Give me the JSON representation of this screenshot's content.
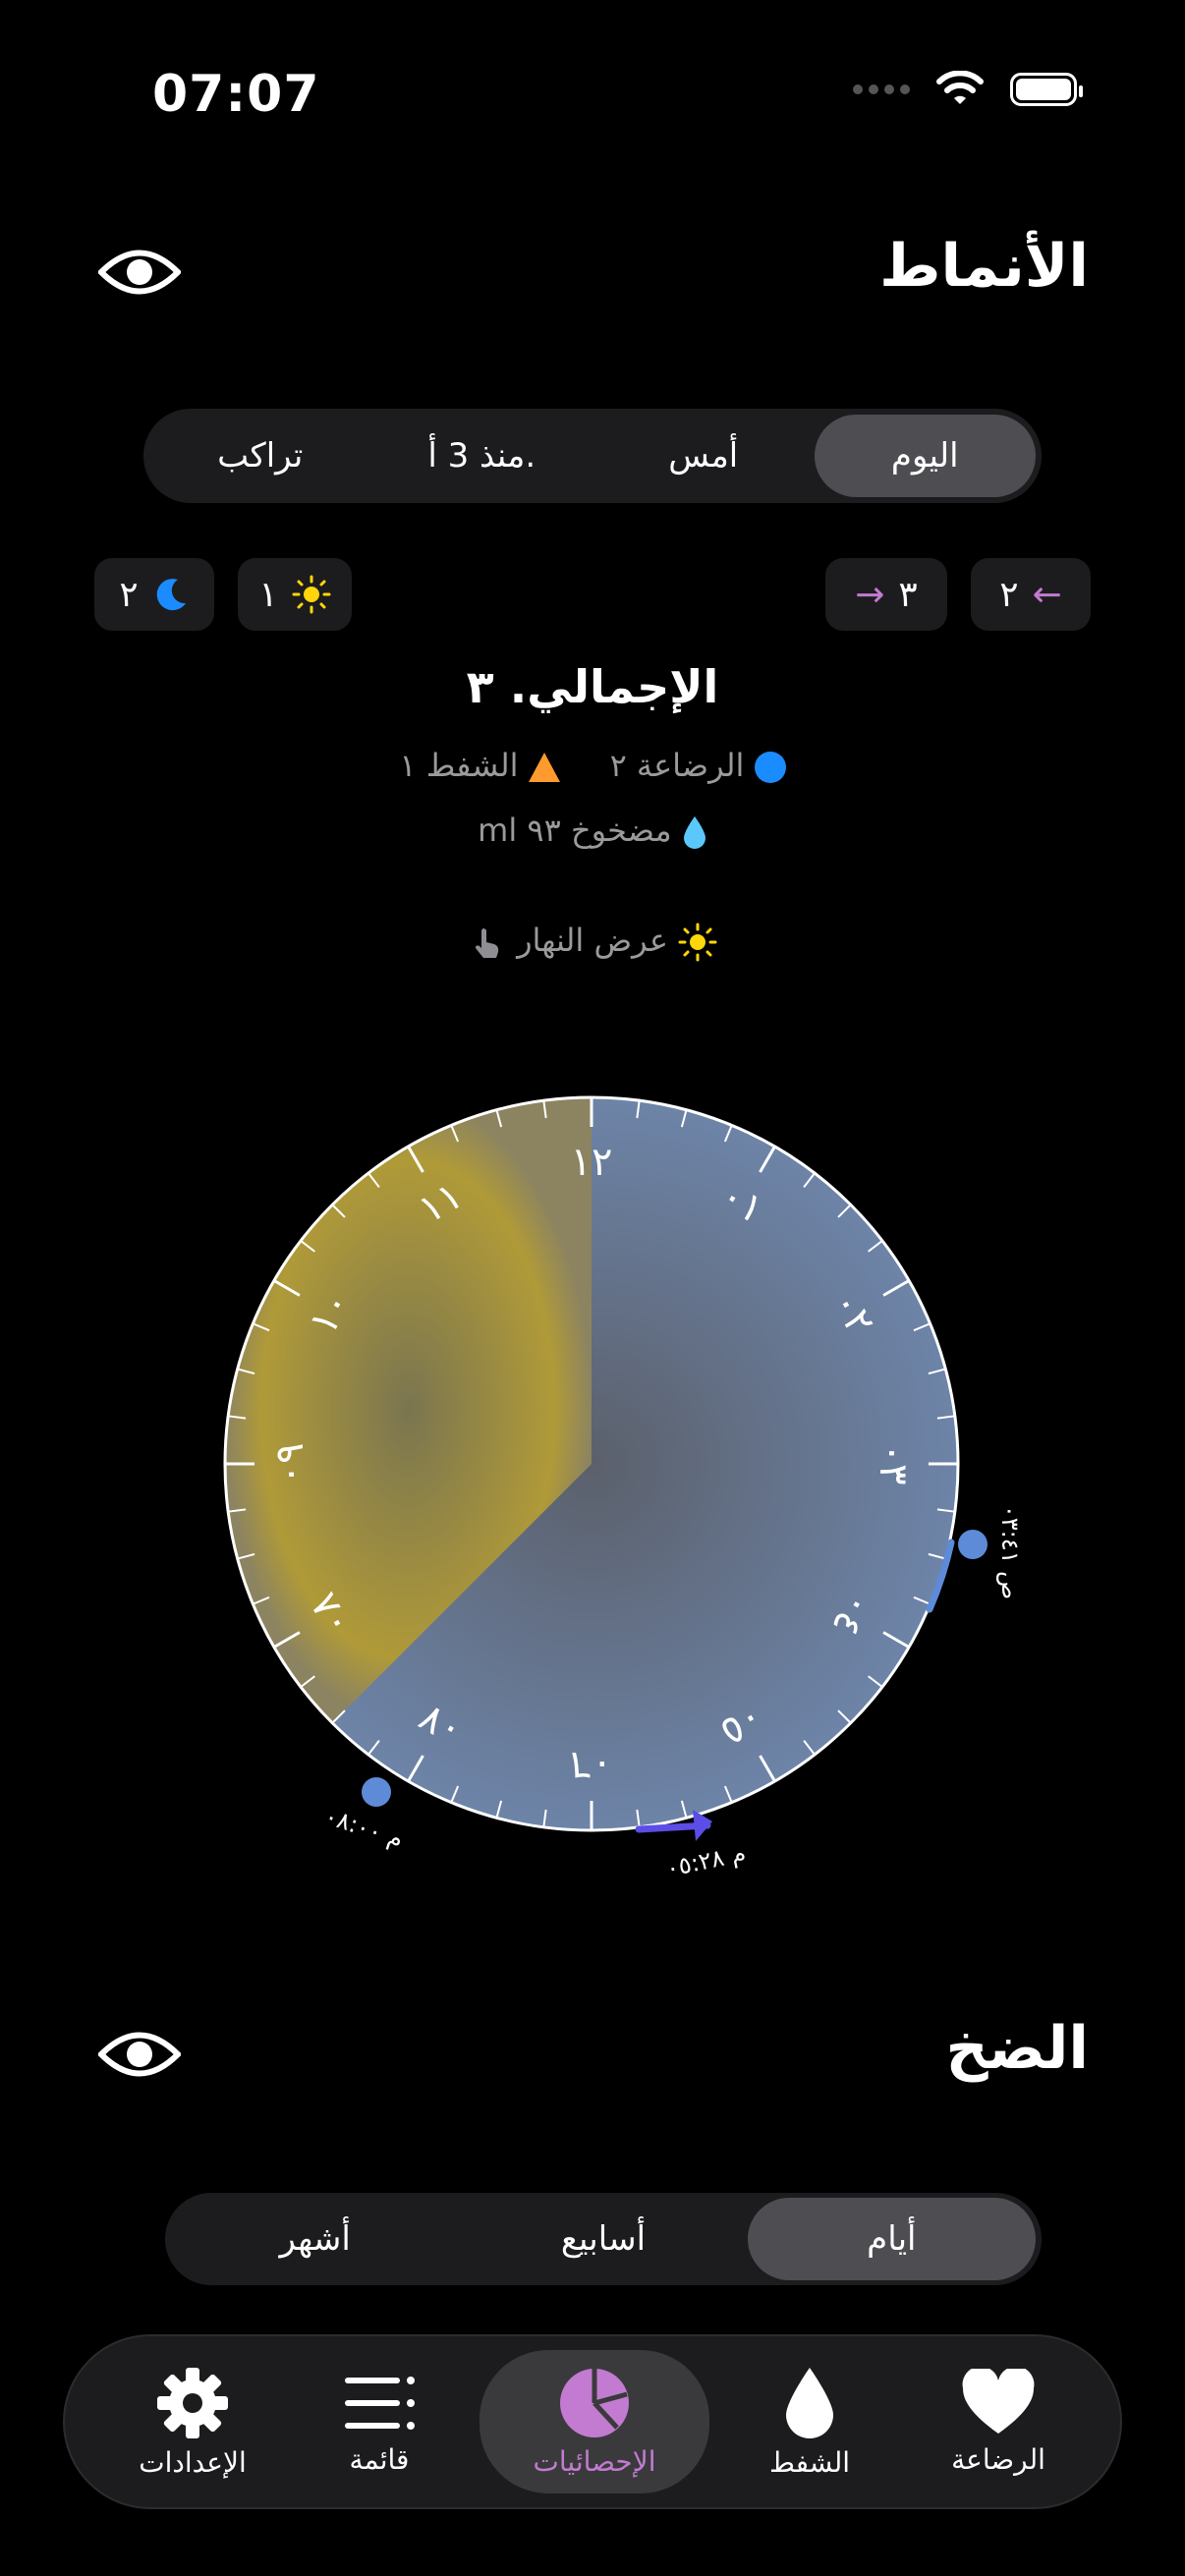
{
  "status": {
    "time": "07:07"
  },
  "patterns": {
    "title": "الأنماط",
    "segments": [
      {
        "label": "اليوم",
        "active": true
      },
      {
        "label": "أمس",
        "active": false
      },
      {
        "label": "منذ 3 أ.",
        "active": false
      },
      {
        "label": "تراكب",
        "active": false
      }
    ],
    "chips": {
      "left_count": "٢",
      "right_count": "٣",
      "sun_count": "١",
      "moon_count": "٢"
    },
    "total": "الإجمالي. ٣",
    "legend": {
      "feeding": "الرضاعة ٢",
      "pumping": "الشفط ١",
      "pumped": "مضخوخ ٩٣ ml"
    },
    "day_view": "عرض النهار",
    "clock": {
      "hour_labels": [
        "١٢",
        "٠١",
        "٠٢",
        "٠٣",
        "٠٤",
        "٠٥",
        "٠٦",
        "٠٧",
        "٠٨",
        "٠٩",
        "١٠",
        "١١"
      ],
      "events": [
        {
          "label": "ص ٠٣:٤١"
        },
        {
          "label": "م ٠٥:٢٨"
        },
        {
          "label": "م ٠٨:٠٠"
        }
      ]
    }
  },
  "pumping_section": {
    "title": "الضخ",
    "segments": [
      {
        "label": "أيام",
        "active": true
      },
      {
        "label": "أسابيع",
        "active": false
      },
      {
        "label": "أشهر",
        "active": false
      }
    ]
  },
  "tabbar": {
    "items": [
      {
        "label": "الإعدادات",
        "icon": "gear-icon"
      },
      {
        "label": "قائمة",
        "icon": "list-icon"
      },
      {
        "label": "الإحصائيات",
        "icon": "pie-chart-icon",
        "active": true
      },
      {
        "label": "الشفط",
        "icon": "drop-icon"
      },
      {
        "label": "الرضاعة",
        "icon": "heart-icon"
      }
    ]
  },
  "colors": {
    "accent": "#c27bd0",
    "feeding": "#1a8cff",
    "pumping": "#ff9a2e",
    "day": "#b89d33",
    "night": "#6b7fa0"
  }
}
